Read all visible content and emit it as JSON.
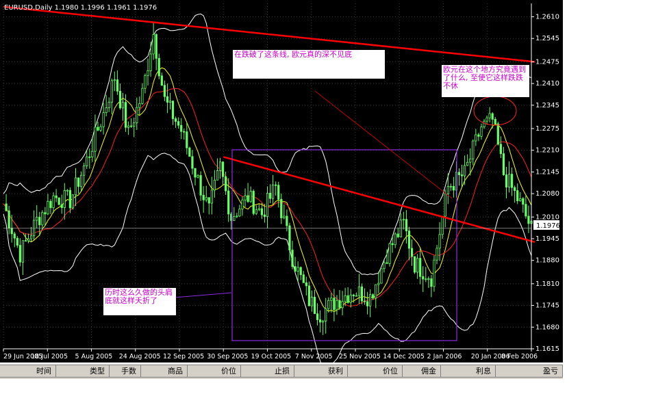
{
  "chart_data": {
    "type": "candlestick",
    "symbol_header": "EURUSD,Daily  1.1980 1.1996 1.1961 1.1976",
    "ylim": [
      1.1615,
      1.265
    ],
    "y_ticks": [
      "1.2610",
      "1.2545",
      "1.2475",
      "1.2410",
      "1.2345",
      "1.2275",
      "1.2210",
      "1.2145",
      "1.2080",
      "1.2010",
      "1.1945",
      "1.1880",
      "1.1810",
      "1.1745",
      "1.1680",
      "1.1615"
    ],
    "x_ticks": [
      "29 Jun 2005",
      "18 Jul 2005",
      "5 Aug 2005",
      "24 Aug 2005",
      "12 Sep 2005",
      "30 Sep 2005",
      "19 Oct 2005",
      "7 Nov 2005",
      "25 Nov 2005",
      "14 Dec 2005",
      "2 Jan 2006",
      "20 Jan 2006",
      "8 Feb 2006"
    ],
    "current_price": "1.1976",
    "close_path": [
      [
        0,
        1.205
      ],
      [
        6,
        1.19
      ],
      [
        12,
        1.2
      ],
      [
        18,
        1.207
      ],
      [
        24,
        1.206
      ],
      [
        30,
        1.218
      ],
      [
        36,
        1.232
      ],
      [
        40,
        1.243
      ],
      [
        45,
        1.226
      ],
      [
        50,
        1.238
      ],
      [
        54,
        1.256
      ],
      [
        58,
        1.236
      ],
      [
        64,
        1.227
      ],
      [
        70,
        1.212
      ],
      [
        74,
        1.203
      ],
      [
        78,
        1.216
      ],
      [
        82,
        1.201
      ],
      [
        88,
        1.207
      ],
      [
        93,
        1.202
      ],
      [
        98,
        1.21
      ],
      [
        104,
        1.189
      ],
      [
        110,
        1.176
      ],
      [
        114,
        1.172
      ],
      [
        120,
        1.176
      ],
      [
        126,
        1.179
      ],
      [
        132,
        1.177
      ],
      [
        138,
        1.19
      ],
      [
        144,
        1.199
      ],
      [
        148,
        1.187
      ],
      [
        154,
        1.183
      ],
      [
        160,
        1.21
      ],
      [
        166,
        1.214
      ],
      [
        172,
        1.228
      ],
      [
        176,
        1.23
      ],
      [
        180,
        1.214
      ],
      [
        186,
        1.205
      ],
      [
        190,
        1.1975
      ]
    ],
    "trendlines": [
      {
        "from": [
          "29 Jun 2005",
          1.264
        ],
        "to": [
          "8 Feb 2006",
          1.2475
        ],
        "color": "#ff0000"
      },
      {
        "from": [
          "30 Sep 2005",
          1.219
        ],
        "to": [
          "8 Feb 2006",
          1.1935
        ],
        "color": "#ff0000"
      }
    ],
    "colors": {
      "candles": "#66ff66",
      "upper_band": "#ffffff",
      "ma_fast": "#ffff00",
      "ma_slow": "#ff2020",
      "box": "#8a2be2",
      "trendline": "#ff0000"
    }
  },
  "annotations": {
    "note1": "在跌破了这条线, 欧元真的深不见底",
    "note2": "欧元在这个地方究竟遇到了什么, 至使它这样跌跌不休",
    "note3": "历时这么久做的头肩底就这样夭折了"
  },
  "terminal_columns": [
    "时间",
    "类型",
    "手数",
    "商品",
    "价位",
    "止损",
    "获利",
    "价位",
    "佣金",
    "利息",
    "盈亏"
  ]
}
